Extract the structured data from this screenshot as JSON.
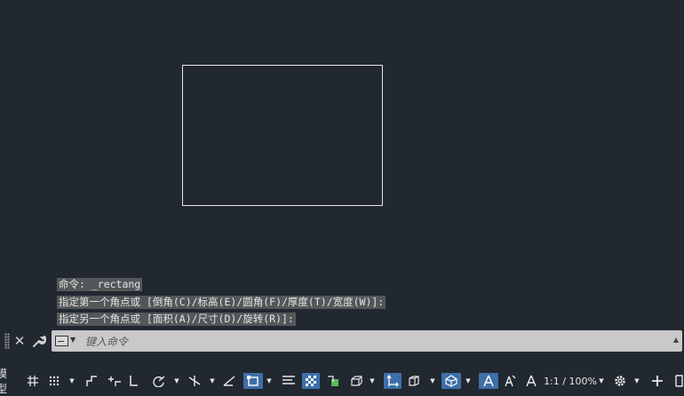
{
  "history": [
    "命令: _rectang",
    "指定第一个角点或 [倒角(C)/标高(E)/圆角(F)/厚度(T)/宽度(W)]:",
    "指定另一个角点或 [面积(A)/尺寸(D)/旋转(R)]:"
  ],
  "command": {
    "placeholder": "键入命令"
  },
  "status": {
    "model_label": "模型",
    "scale": "1:1 / 100%"
  },
  "colors": {
    "background": "#212830",
    "command_line": "#c9c9c9",
    "active_toggle": "#3e6fa8"
  },
  "icons": [
    "close-icon",
    "wrench-icon",
    "command-prompt-icon",
    "grid-icon",
    "snap-icon",
    "ortho-icon",
    "polar-icon",
    "osnap-icon",
    "otrack-icon",
    "lineweight-icon",
    "transparency-icon",
    "selection-cycling-icon",
    "3d-osnap-icon",
    "dynamic-ucs-icon",
    "gizmo-icon",
    "annotation-visibility-icon",
    "auto-scale-icon",
    "annotation-scale-icon",
    "gear-icon",
    "plus-icon"
  ]
}
